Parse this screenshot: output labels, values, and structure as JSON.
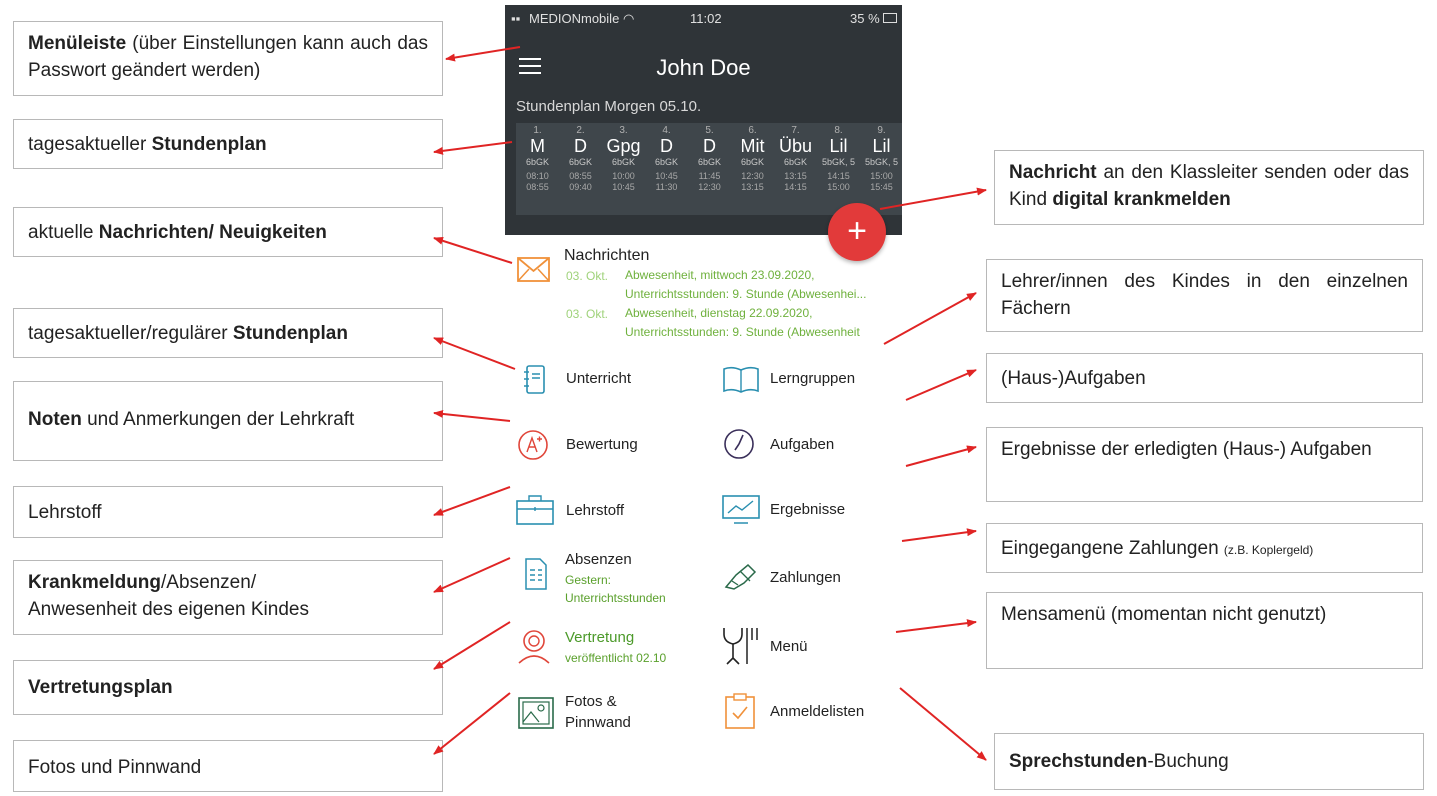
{
  "status_bar": {
    "carrier": "MEDIONmobile",
    "time": "11:02",
    "battery": "35 %"
  },
  "app": {
    "user_name": "John Doe",
    "schedule_title": "Stundenplan Morgen 05.10.",
    "schedule": [
      {
        "n": "1.",
        "subject": "M",
        "group": "6bGK",
        "start": "08:10",
        "end": "08:55"
      },
      {
        "n": "2.",
        "subject": "D",
        "group": "6bGK",
        "start": "08:55",
        "end": "09:40"
      },
      {
        "n": "3.",
        "subject": "Gpg",
        "group": "6bGK",
        "start": "10:00",
        "end": "10:45"
      },
      {
        "n": "4.",
        "subject": "D",
        "group": "6bGK",
        "start": "10:45",
        "end": "11:30"
      },
      {
        "n": "5.",
        "subject": "D",
        "group": "6bGK",
        "start": "11:45",
        "end": "12:30"
      },
      {
        "n": "6.",
        "subject": "Mit",
        "group": "6bGK",
        "start": "12:30",
        "end": "13:15"
      },
      {
        "n": "7.",
        "subject": "Übu",
        "group": "6bGK",
        "start": "13:15",
        "end": "14:15"
      },
      {
        "n": "8.",
        "subject": "Lil",
        "group": "5bGK, 5",
        "start": "14:15",
        "end": "15:00"
      },
      {
        "n": "9.",
        "subject": "Lil",
        "group": "5bGK, 5",
        "start": "15:00",
        "end": "15:45"
      }
    ],
    "fab_symbol": "+",
    "news": {
      "title": "Nachrichten",
      "items": [
        {
          "date": "03. Okt.",
          "line1": "Abwesenheit, mittwoch 23.09.2020,",
          "line2": "Unterrichtsstunden: 9. Stunde (Abwesenhei..."
        },
        {
          "date": "03. Okt.",
          "line1": "Abwesenheit, dienstag 22.09.2020,",
          "line2": "Unterrichtsstunden: 9. Stunde (Abwesenheit"
        }
      ]
    },
    "menu": {
      "unterricht": "Unterricht",
      "lerngruppen": "Lerngruppen",
      "bewertung": "Bewertung",
      "aufgaben": "Aufgaben",
      "lehrstoff": "Lehrstoff",
      "ergebnisse": "Ergebnisse",
      "absenzen": "Absenzen",
      "absenzen_sub1": "Gestern:",
      "absenzen_sub2": "Unterrichtsstunden",
      "zahlungen": "Zahlungen",
      "vertretung": "Vertretung",
      "vertretung_sub": "veröffentlicht 02.10",
      "menue": "Menü",
      "fotos1": "Fotos &",
      "fotos2": "Pinnwand",
      "anmeldelisten": "Anmeldelisten"
    }
  },
  "callouts_left": {
    "menuleiste_bold": "Menüleiste",
    "menuleiste_rest": " (über Einstellungen kann auch das Passwort geändert werden)",
    "stundenplan_pre": "tagesaktueller ",
    "stundenplan_bold": "Stundenplan",
    "nachrichten_pre": "aktuelle ",
    "nachrichten_bold": "Nachrichten/ Neuigkeiten",
    "regulaer_pre": "tagesaktueller/regulärer ",
    "regulaer_bold": "Stundenplan",
    "noten_bold": "Noten",
    "noten_rest": " und Anmerkungen der Lehrkraft",
    "lehrstoff": "Lehrstoff",
    "krank_bold": "Krankmeldung",
    "krank_rest1": "/Absenzen/",
    "krank_rest2": "Anwesenheit des eigenen Kindes",
    "vertretungsplan_bold": "Vertretungsplan",
    "fotos": "Fotos und Pinnwand"
  },
  "callouts_right": {
    "nachricht_bold": "Nachricht",
    "nachricht_mid": " an den Klassleiter senden oder das Kind ",
    "nachricht_bold2": "digital krankmelden",
    "lehrer": "Lehrer/innen des Kindes in den einzelnen Fächern",
    "aufgaben": "(Haus-)Aufgaben",
    "ergebnisse": "Ergebnisse der erledigten (Haus-) Aufgaben",
    "zahlungen": "Eingegangene Zahlungen ",
    "zahlungen_small": "(z.B. Koplergeld)",
    "mensa": "Mensamenü (momentan nicht genutzt)",
    "sprech_bold": "Sprechstunden",
    "sprech_rest": "-Buchung"
  },
  "colors": {
    "arrow": "#e02424",
    "app_dark": "#2f3438",
    "fab": "#e23a3a",
    "accent_green": "#5aa02c",
    "icon_teal": "#2a8fb0",
    "icon_orange": "#f0913a",
    "icon_red": "#e0463a"
  }
}
